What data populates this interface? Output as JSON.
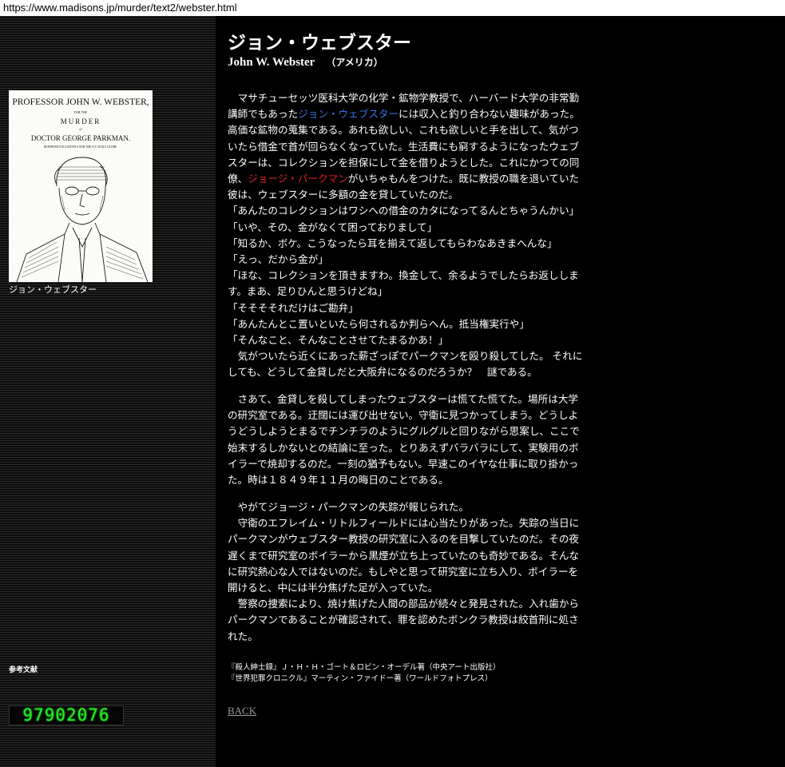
{
  "browser": {
    "url": "https://www.madisons.jp/murder/text2/webster.html"
  },
  "sidebar": {
    "portrait": {
      "line1": "PROFESSOR JOHN W. WEBSTER,",
      "line2": "FOR THE",
      "line3": "MURDER",
      "line4": "of",
      "line5": "DOCTOR GEORGE PARKMAN.",
      "line6": "REPORTED EXCLUSIVELY FOR THE N.Y. DAILY GLOBE."
    },
    "caption": "ジョン・ウェブスター",
    "refs_heading": "参考文献",
    "counter": "97902076"
  },
  "main": {
    "title": "ジョン・ウェブスター",
    "name_en": "John W. Webster",
    "country": "（アメリカ）",
    "p1": {
      "l1": "　マサチューセッツ医科大学の化学・鉱物学教授で、ハーバード大学の非常勤",
      "l2a": "講師でもあった",
      "l2_link": "ジョン・ウェブスター",
      "l2b": "には収入と釣り合わない趣味があった。",
      "l3": "高価な鉱物の蒐集である。あれも欲しい、これも欲しいと手を出して、気がつ",
      "l4": "いたら借金で首が回らなくなっていた。生活費にも窮するようになったウェブ",
      "l5": "スターは、コレクションを担保にして金を借りようとした。これにかつての同",
      "l6a": "僚、",
      "l6_link": "ジョージ・パークマン",
      "l6b": "がいちゃもんをつけた。既に教授の職を退いていた",
      "l7": "彼は、ウェブスターに多額の金を貸していたのだ。",
      "l8": "「あんたのコレクションはワシへの借金のカタになってるんとちゃうんかい」",
      "l9": "「いや、その、金がなくて困っておりまして」",
      "l10": "「知るか、ボケ。こうなったら耳を揃えて返してもらわなあきまへんな」",
      "l11": "「えっ、だから金が」",
      "l12": "「ほな、コレクションを頂きますわ。換金して、余るようでしたらお返ししま",
      "l13": "す。まあ、足りひんと思うけどね」",
      "l14": "「そそそそれだけはご勘弁」",
      "l15": "「あんたんとこ置いといたら何されるか判らへん。抵当権実行や」",
      "l16": "「そんなこと、そんなことさせてたまるかあ！」",
      "l17": "　気がついたら近くにあった薪ざっぽでパークマンを殴り殺してした。 それに",
      "l18": "しても、どうして金貸しだと大阪弁になるのだろうか？　謎である。"
    },
    "p2": {
      "l1": "　さあて、金貸しを殺してしまったウェブスターは慌てた慌てた。場所は大学",
      "l2": "の研究室である。迂闊には運び出せない。守衛に見つかってしまう。どうしよ",
      "l3": "うどうしようとまるでチンチラのようにグルグルと回りながら思案し、ここで",
      "l4": "始末するしかないとの結論に至った。とりあえずバラバラにして、実験用のボ",
      "l5": "イラーで焼却するのだ。一刻の猶予もない。早速このイヤな仕事に取り掛かっ",
      "l6": "た。時は１８４９年１１月の晦日のことである。"
    },
    "p3": {
      "l1": "　やがてジョージ・パークマンの失踪が報じられた。",
      "l2": "　守衛のエフレイム・リトルフィールドには心当たりがあった。失踪の当日に",
      "l3": "パークマンがウェブスター教授の研究室に入るのを目撃していたのだ。その夜",
      "l4": "遅くまで研究室のボイラーから黒煙が立ち上っていたのも奇妙である。そんな",
      "l5": "に研究熱心な人ではないのだ。もしやと思って研究室に立ち入り、ボイラーを",
      "l6": "開けると、中には半分焦げた足が入っていた。",
      "l7": "　警察の捜索により、焼け焦げた人間の部品が続々と発見された。入れ歯から",
      "l8": "パークマンであることが確認されて、罪を認めたボンクラ教授は絞首刑に処さ",
      "l9": "れた。"
    },
    "refs": [
      "『殺人紳士録』Ｊ・Ｈ・Ｈ・ゴート＆ロビン・オーデル著（中央アート出版社）",
      "『世界犯罪クロニクル』マーティン・ファイドー著（ワールドフォトプレス）"
    ],
    "back": "BACK"
  }
}
